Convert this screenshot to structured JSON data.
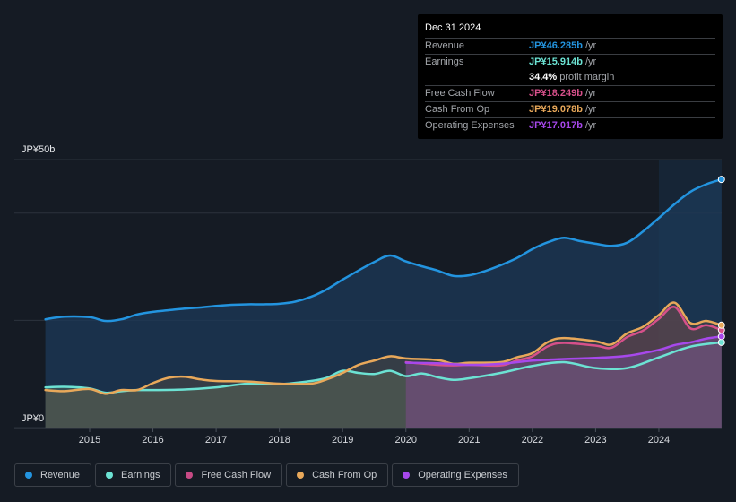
{
  "tooltip": {
    "date": "Dec 31 2024",
    "rows": [
      {
        "label": "Revenue",
        "value": "JP¥46.285b",
        "unit": "/yr",
        "color": "#2394df"
      },
      {
        "label": "Earnings",
        "value": "JP¥15.914b",
        "unit": "/yr",
        "color": "#6ce2d3"
      },
      {
        "label": "",
        "value": "34.4%",
        "unit": "profit margin",
        "color": "#ffffff"
      },
      {
        "label": "Free Cash Flow",
        "value": "JP¥18.249b",
        "unit": "/yr",
        "color": "#d6508a"
      },
      {
        "label": "Cash From Op",
        "value": "JP¥19.078b",
        "unit": "/yr",
        "color": "#e8a85a"
      },
      {
        "label": "Operating Expenses",
        "value": "JP¥17.017b",
        "unit": "/yr",
        "color": "#a748ec"
      }
    ]
  },
  "legend": [
    {
      "label": "Revenue",
      "color": "#2394df"
    },
    {
      "label": "Earnings",
      "color": "#6ce2d3"
    },
    {
      "label": "Free Cash Flow",
      "color": "#c74a85"
    },
    {
      "label": "Cash From Op",
      "color": "#e8a85a"
    },
    {
      "label": "Operating Expenses",
      "color": "#a748ec"
    }
  ],
  "chart_data": {
    "type": "area",
    "title": "",
    "xlabel": "",
    "ylabel": "",
    "y_tick_labels": [
      "JP¥0",
      "JP¥50b"
    ],
    "x_tick_labels": [
      "2015",
      "2016",
      "2017",
      "2018",
      "2019",
      "2020",
      "2021",
      "2022",
      "2023",
      "2024"
    ],
    "xlim": [
      2014.25,
      2025.0
    ],
    "ylim": [
      0,
      50
    ],
    "units": "JP¥ billions",
    "highlight_start": 2024.0,
    "series": [
      {
        "name": "Revenue",
        "color": "#2394df",
        "x": [
          2014.3,
          2014.6,
          2015.0,
          2015.25,
          2015.5,
          2015.75,
          2016.0,
          2016.25,
          2016.5,
          2016.75,
          2017.0,
          2017.25,
          2017.5,
          2017.75,
          2018.0,
          2018.25,
          2018.5,
          2018.75,
          2019.0,
          2019.25,
          2019.5,
          2019.75,
          2020.0,
          2020.25,
          2020.5,
          2020.75,
          2021.0,
          2021.25,
          2021.5,
          2021.75,
          2022.0,
          2022.25,
          2022.5,
          2022.75,
          2023.0,
          2023.25,
          2023.5,
          2023.75,
          2024.0,
          2024.25,
          2024.5,
          2024.75,
          2024.99
        ],
        "y": [
          20.2,
          20.7,
          20.6,
          19.9,
          20.2,
          21.1,
          21.6,
          21.9,
          22.2,
          22.4,
          22.7,
          22.9,
          23.0,
          23.0,
          23.1,
          23.5,
          24.4,
          25.8,
          27.6,
          29.3,
          30.9,
          32.1,
          31.0,
          30.1,
          29.3,
          28.3,
          28.4,
          29.2,
          30.3,
          31.6,
          33.3,
          34.6,
          35.4,
          34.8,
          34.3,
          33.9,
          34.5,
          36.6,
          39.1,
          41.7,
          44.0,
          45.4,
          46.3
        ]
      },
      {
        "name": "Earnings",
        "color": "#6ce2d3",
        "x": [
          2014.3,
          2014.6,
          2015.0,
          2015.25,
          2015.5,
          2015.75,
          2016.0,
          2016.5,
          2017.0,
          2017.5,
          2018.0,
          2018.5,
          2018.75,
          2019.0,
          2019.25,
          2019.5,
          2019.75,
          2020.0,
          2020.25,
          2020.5,
          2020.75,
          2021.0,
          2021.5,
          2022.0,
          2022.5,
          2023.0,
          2023.5,
          2024.0,
          2024.5,
          2024.99
        ],
        "y": [
          7.5,
          7.6,
          7.3,
          6.5,
          6.8,
          7.0,
          7.0,
          7.1,
          7.5,
          8.2,
          8.1,
          8.7,
          9.3,
          10.6,
          10.2,
          10.0,
          10.6,
          9.6,
          10.1,
          9.4,
          8.9,
          9.2,
          10.2,
          11.5,
          12.2,
          11.1,
          11.1,
          13.1,
          15.1,
          15.9
        ]
      },
      {
        "name": "Free Cash Flow",
        "color": "#d6508a",
        "x": [
          2020.0,
          2020.5,
          2020.75,
          2021.0,
          2021.5,
          2021.75,
          2022.0,
          2022.25,
          2022.5,
          2023.0,
          2023.25,
          2023.5,
          2023.75,
          2024.0,
          2024.25,
          2024.5,
          2024.75,
          2024.99
        ],
        "y": [
          12.2,
          11.7,
          11.6,
          11.7,
          11.6,
          12.5,
          13.3,
          15.2,
          15.8,
          15.3,
          14.9,
          16.9,
          18.1,
          20.3,
          22.5,
          18.5,
          19.1,
          18.2
        ]
      },
      {
        "name": "Cash From Op",
        "color": "#e8a85a",
        "x": [
          2014.3,
          2014.6,
          2015.0,
          2015.25,
          2015.5,
          2015.75,
          2016.0,
          2016.25,
          2016.5,
          2016.75,
          2017.0,
          2017.5,
          2018.0,
          2018.5,
          2018.75,
          2019.0,
          2019.25,
          2019.5,
          2019.75,
          2020.0,
          2020.5,
          2020.75,
          2021.0,
          2021.5,
          2021.75,
          2022.0,
          2022.25,
          2022.5,
          2023.0,
          2023.25,
          2023.5,
          2023.75,
          2024.0,
          2024.25,
          2024.5,
          2024.75,
          2024.99
        ],
        "y": [
          7.0,
          6.8,
          7.2,
          6.3,
          7.0,
          7.0,
          8.3,
          9.3,
          9.5,
          9.0,
          8.7,
          8.6,
          8.2,
          8.2,
          9.0,
          10.2,
          11.7,
          12.5,
          13.3,
          12.9,
          12.6,
          11.9,
          12.1,
          12.2,
          13.1,
          13.9,
          16.0,
          16.7,
          16.1,
          15.5,
          17.6,
          18.8,
          21.0,
          23.3,
          19.5,
          19.9,
          19.1
        ]
      },
      {
        "name": "Operating Expenses",
        "color": "#a748ec",
        "x": [
          2020.0,
          2020.5,
          2021.0,
          2021.5,
          2022.0,
          2022.5,
          2023.0,
          2023.5,
          2024.0,
          2024.25,
          2024.5,
          2024.75,
          2024.99
        ],
        "y": [
          12.1,
          12.0,
          11.7,
          11.9,
          12.5,
          12.8,
          13.0,
          13.4,
          14.5,
          15.4,
          15.9,
          16.6,
          17.0
        ]
      }
    ]
  }
}
